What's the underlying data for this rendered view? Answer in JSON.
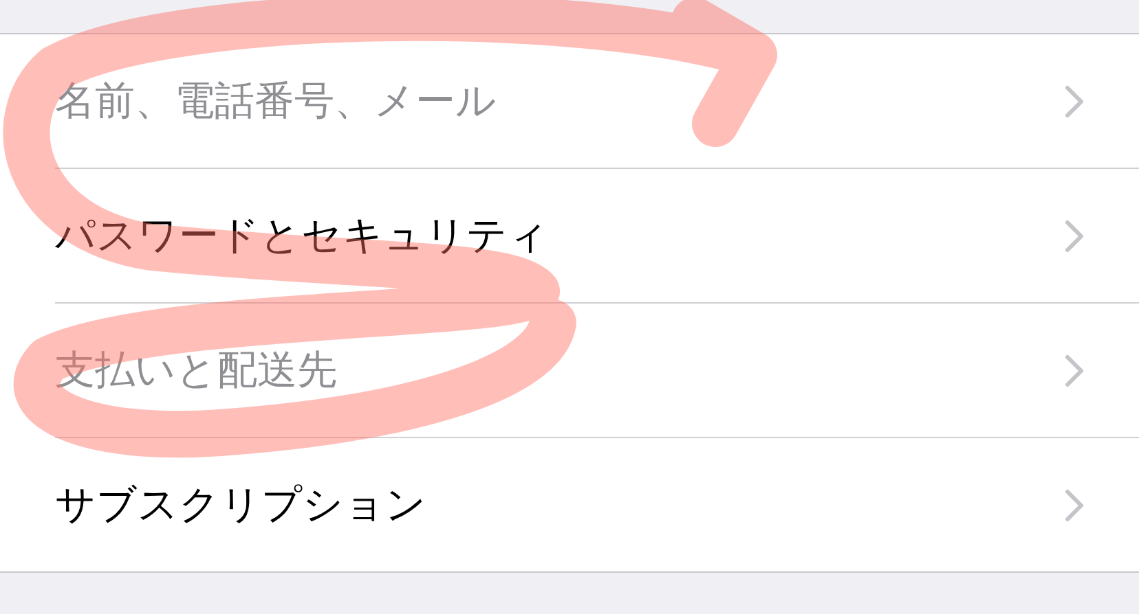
{
  "rows": [
    {
      "label": "名前、電話番号、メール",
      "disabled": true
    },
    {
      "label": "パスワードとセキュリティ",
      "disabled": false
    },
    {
      "label": "支払いと配送先",
      "disabled": true
    },
    {
      "label": "サブスクリプション",
      "disabled": false
    }
  ],
  "markup": {
    "kind": "scribble"
  }
}
